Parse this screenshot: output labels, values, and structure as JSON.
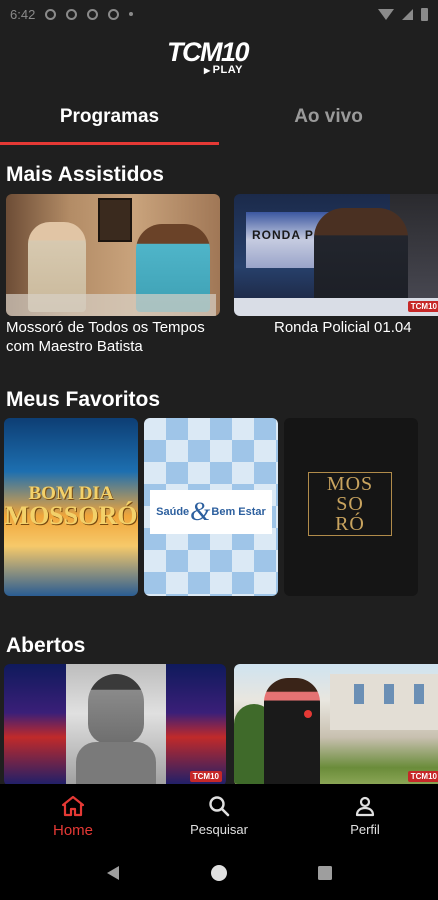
{
  "status_bar": {
    "time": "6:42"
  },
  "app": {
    "logo_text": "TCM10",
    "logo_sub": "PLAY"
  },
  "tabs": [
    {
      "label": "Programas",
      "active": true
    },
    {
      "label": "Ao vivo",
      "active": false
    }
  ],
  "sections": {
    "mais_assistidos": {
      "title": "Mais Assistidos",
      "items": [
        {
          "caption": "Mossoró de Todos os Tempos com Maestro Batista"
        },
        {
          "caption": "Ronda Policial 01.04",
          "thumb_label": "RONDA POLICIAL"
        }
      ]
    },
    "meus_favoritos": {
      "title": "Meus Favoritos",
      "items": [
        {
          "line1": "BOM DIA",
          "line2": "MOSSORÓ"
        },
        {
          "left": "Saúde",
          "amp": "&",
          "right": "Bem Estar"
        },
        {
          "line1": "MOS",
          "line2": "SO",
          "line3": "RÓ"
        }
      ]
    },
    "abertos": {
      "title": "Abertos"
    }
  },
  "mini_logo": "TCM10",
  "bottom_nav": [
    {
      "label": "Home",
      "icon": "home-icon",
      "active": true
    },
    {
      "label": "Pesquisar",
      "icon": "search-icon",
      "active": false
    },
    {
      "label": "Perfil",
      "icon": "profile-icon",
      "active": false
    }
  ],
  "colors": {
    "accent": "#e53935",
    "background": "#1f1f1f",
    "nav_background": "#000000"
  }
}
